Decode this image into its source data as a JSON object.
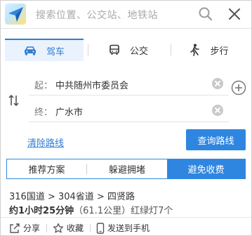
{
  "search": {
    "placeholder": "搜索位置、公交站、地铁站"
  },
  "modes": [
    {
      "label": "驾车",
      "icon": "car-icon",
      "active": true
    },
    {
      "label": "公交",
      "icon": "bus-icon",
      "active": false
    },
    {
      "label": "步行",
      "icon": "walk-icon",
      "active": false
    }
  ],
  "route": {
    "start_label": "起：",
    "start_value": "中共随州市委员会",
    "end_label": "终：",
    "end_value": "广水市"
  },
  "actions": {
    "clear_label": "清除路线",
    "query_label": "查询路线"
  },
  "preferences": [
    {
      "label": "推荐方案",
      "active": false
    },
    {
      "label": "躲避拥堵",
      "active": false
    },
    {
      "label": "避免收费",
      "active": true
    }
  ],
  "result": {
    "path": "316国道 > 304省道 > 四贤路",
    "time": "约1小时25分钟",
    "distance": "（61.1公里）",
    "lights": "红绿灯7个"
  },
  "result_actions": [
    {
      "label": "分享",
      "icon": "share-icon"
    },
    {
      "label": "收藏",
      "icon": "star-icon"
    },
    {
      "label": "发送到手机",
      "icon": "phone-icon"
    }
  ],
  "colors": {
    "accent": "#2f86e0",
    "active_tab_bg": "#eaf3fd"
  }
}
